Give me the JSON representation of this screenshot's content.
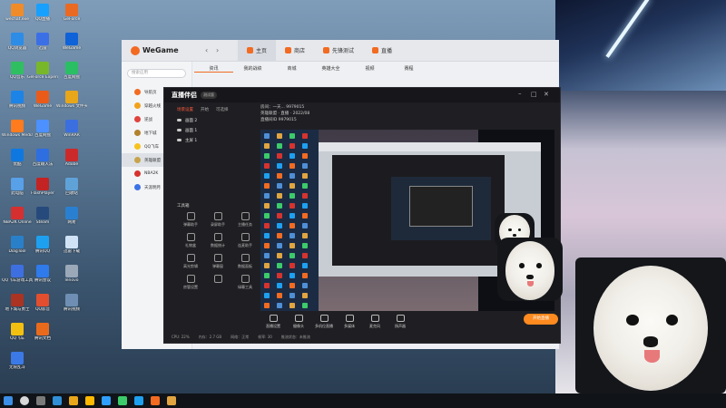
{
  "desktop": {
    "icons_left": [
      {
        "label": "wechat.exe",
        "color": "#f08b2a"
      },
      {
        "label": "QQ浏览器",
        "color": "#2c8ce6"
      },
      {
        "label": "QQ音乐",
        "color": "#2fbf60"
      },
      {
        "label": "腾讯视频",
        "color": "#1c84e7"
      },
      {
        "label": "Windows Media Player",
        "color": "#ff7b1e"
      },
      {
        "label": "优酷",
        "color": "#0f78e0"
      },
      {
        "label": "此电脑",
        "color": "#58a0e8"
      },
      {
        "label": "NBA2K Online",
        "color": "#d62f2f"
      },
      {
        "label": "DiagTool",
        "color": "#2a80c8"
      },
      {
        "label": "QQ飞车游戏工具",
        "color": "#3e6fe0"
      },
      {
        "label": "地下城与勇士",
        "color": "#a32"
      },
      {
        "label": "QQ飞车",
        "color": "#f2c010"
      },
      {
        "label": "无限乱斗",
        "color": "#3b7ae6"
      }
    ],
    "icons_col2": [
      {
        "label": "QQ直播",
        "color": "#18a0ff"
      },
      {
        "label": "迅雷",
        "color": "#3b6fe6"
      },
      {
        "label": "GeForce Experience",
        "color": "#78b72a"
      },
      {
        "label": "WeGame",
        "color": "#ea5b1a"
      },
      {
        "label": "百度网盘",
        "color": "#4c91ff"
      },
      {
        "label": "百度输入法",
        "color": "#2e6ee0"
      },
      {
        "label": "FlashPlayer",
        "color": "#c42323"
      },
      {
        "label": "Steam",
        "color": "#274a7c"
      },
      {
        "label": "腾讯QQ",
        "color": "#1ea0f0"
      },
      {
        "label": "腾讯会议",
        "color": "#2f7bec"
      },
      {
        "label": "QQ影音",
        "color": "#e34e2f"
      },
      {
        "label": "腾讯文档",
        "color": "#ea6a1c"
      }
    ],
    "icons_col3": [
      {
        "label": "GeForce",
        "color": "#ea6a24"
      },
      {
        "label": "WeGame",
        "color": "#0f62d8"
      },
      {
        "label": "百度网盘",
        "color": "#2bbf64"
      },
      {
        "label": "Windows 文件夹",
        "color": "#e8a61a"
      },
      {
        "label": "WinRAR",
        "color": "#3b6fe0"
      },
      {
        "label": "Adobe",
        "color": "#cc2a2a"
      },
      {
        "label": "回收站",
        "color": "#5fa2d8"
      },
      {
        "label": "网易",
        "color": "#2a80d0"
      },
      {
        "label": "迅雷下载",
        "color": "#d0e3f6"
      },
      {
        "label": "lenovo",
        "color": "#9aa8b8"
      },
      {
        "label": "腾讯视频",
        "color": "#6e8fb3"
      }
    ]
  },
  "wegame": {
    "logo": "WeGame",
    "nav": [
      {
        "label": "主页",
        "active": true
      },
      {
        "label": "商店",
        "active": false
      },
      {
        "label": "先锋测试",
        "active": false
      },
      {
        "label": "直播",
        "active": false
      }
    ],
    "search_placeholder": "搜索应用",
    "games": [
      {
        "label": "导航页",
        "color": "#f26b21",
        "selected": false
      },
      {
        "label": "穿越火线",
        "color": "#f2a21a",
        "selected": false
      },
      {
        "label": "逆战",
        "color": "#e0433d",
        "selected": false
      },
      {
        "label": "地下城",
        "color": "#b2822c",
        "selected": false
      },
      {
        "label": "QQ飞车",
        "color": "#f7c21c",
        "selected": false
      },
      {
        "label": "英雄联盟",
        "color": "#c7a44b",
        "selected": true
      },
      {
        "label": "NBA2K",
        "color": "#d6332f",
        "selected": false
      },
      {
        "label": "天涯明月",
        "color": "#3c72e6",
        "selected": false
      }
    ],
    "tabs": [
      "资讯",
      "我的战绩",
      "商城",
      "英雄大全",
      "视频",
      "赛程"
    ]
  },
  "zhibo": {
    "logo": "直播伴侣",
    "badge": "测试版",
    "tabs": [
      "场景设置",
      "开始",
      "可选择"
    ],
    "scenes": [
      "画面 2",
      "画面 1",
      "主屏 1"
    ],
    "tools_title": "工具箱",
    "tools": [
      "弹幕助手",
      "录屏助手",
      "主播任务",
      "礼物盒",
      "数据统计",
      "连麦助手",
      "高光剪辑",
      "弹幕窗",
      "数据面板",
      "房管设置",
      "",
      "绿幕工具"
    ],
    "info": [
      "房间：一天...  9979015",
      "英雄联盟 · 直播 · 2022/08",
      "直播间ID  9979015"
    ],
    "bottom": [
      {
        "label": "直播设置"
      },
      {
        "label": "摄像头"
      },
      {
        "label": "多机位直播"
      },
      {
        "label": "多媒体"
      },
      {
        "label": "麦克风"
      },
      {
        "label": "扬声器"
      }
    ],
    "live_button": "开始直播",
    "status": [
      "CPU: 22%",
      "内存：2.7 GB",
      "网络：正常",
      "帧率: 30",
      "推流状态：未推流"
    ]
  }
}
